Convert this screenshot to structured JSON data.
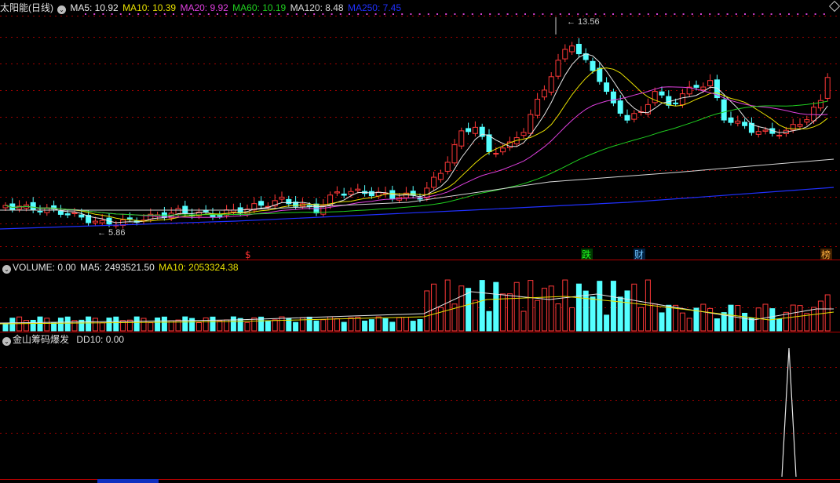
{
  "main": {
    "title": "太阳能(日线)",
    "ma": [
      {
        "label": "MA5: 10.92",
        "color": "#e6e6e6"
      },
      {
        "label": "MA10: 10.39",
        "color": "#e8e000"
      },
      {
        "label": "MA20: 9.92",
        "color": "#e040e0"
      },
      {
        "label": "MA60: 10.19",
        "color": "#20d020"
      },
      {
        "label": "MA120: 8.48",
        "color": "#d8d8d8"
      },
      {
        "label": "MA250: 7.45",
        "color": "#2030ff"
      }
    ],
    "high_label": "13.56",
    "low_label": "5.86",
    "markers": [
      {
        "text": "$",
        "color": "#ff3030",
        "bg": "#000"
      },
      {
        "text": "跌",
        "color": "#20ff20",
        "bg": "#003a00"
      },
      {
        "text": "财",
        "color": "#6fc3ff",
        "bg": "#002040"
      },
      {
        "text": "榜",
        "color": "#ffb040",
        "bg": "#402000"
      }
    ]
  },
  "volume": {
    "label": "VOLUME: 0.00",
    "ma5": "MA5: 2493521.50",
    "ma10": "MA10: 2053324.38"
  },
  "indicator": {
    "name": "金山筹码爆发",
    "label": "DD10: 0.00"
  },
  "colors": {
    "up": "#ff3838",
    "down": "#54ffff",
    "grid": "#a00000",
    "background": "#000000"
  },
  "icons": [
    "settings-circle-icon",
    "expand-diamond-icon"
  ]
}
